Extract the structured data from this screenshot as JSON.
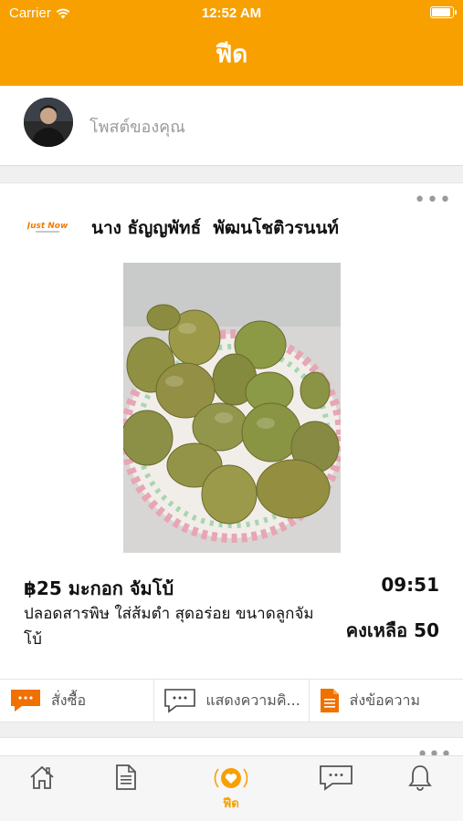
{
  "status_bar": {
    "carrier": "Carrier",
    "time": "12:52 AM",
    "battery_level": 0.9
  },
  "nav": {
    "title": "ฟีด"
  },
  "composer": {
    "placeholder": "โพสต์ของคุณ"
  },
  "post": {
    "brand_logo": "Just Now",
    "author": "นาง ธัญญพัทธ์  พัฒนโชติวรนนท์",
    "product": "฿25 มะกอก จัมโบ้",
    "time": "09:51",
    "description": "ปลอดสารพิษ ใส่ส้มตำ สุดอร่อย ขนาดลูกจัมโบ้",
    "stock": "คงเหลือ 50",
    "actions": [
      {
        "label": "สั่งซื้อ",
        "icon": "chat-bubble-icon"
      },
      {
        "label": "แสดงความคิ...",
        "icon": "comment-icon"
      },
      {
        "label": "ส่งข้อความ",
        "icon": "document-icon"
      }
    ]
  },
  "tabbar": {
    "items": [
      {
        "icon": "home-icon",
        "label": ""
      },
      {
        "icon": "document-icon",
        "label": ""
      },
      {
        "icon": "heart-feed-icon",
        "label": "ฟีด"
      },
      {
        "icon": "message-icon",
        "label": ""
      },
      {
        "icon": "bell-icon",
        "label": ""
      }
    ]
  },
  "colors": {
    "accent": "#f7a000",
    "background": "#f0f0f0"
  }
}
